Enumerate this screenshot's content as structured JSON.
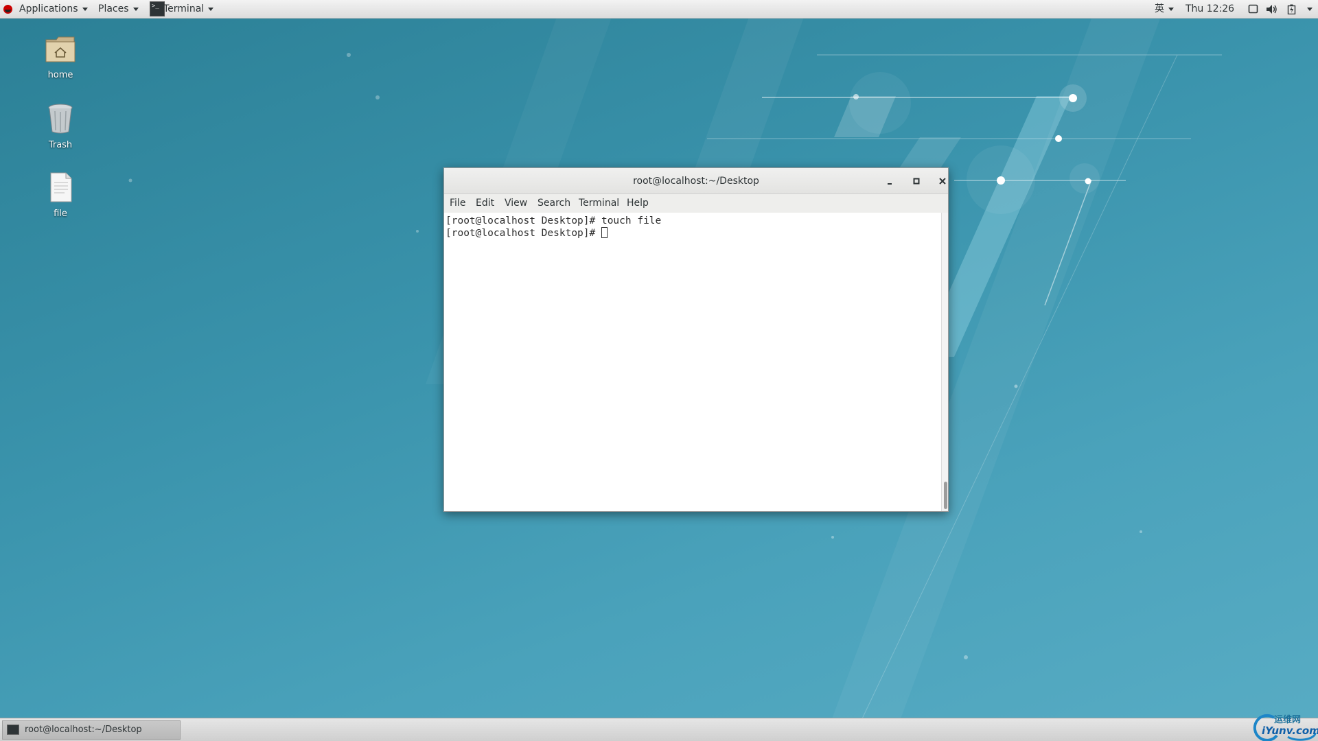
{
  "topbar": {
    "applications_label": "Applications",
    "places_label": "Places",
    "terminal_label": "Terminal",
    "input_method": "英",
    "clock": "Thu 12:26"
  },
  "desktop_icons": [
    {
      "label": "home",
      "icon": "home-folder-icon"
    },
    {
      "label": "Trash",
      "icon": "trash-icon"
    },
    {
      "label": "file",
      "icon": "file-icon"
    }
  ],
  "window": {
    "title": "root@localhost:~/Desktop",
    "menu": [
      "File",
      "Edit",
      "View",
      "Search",
      "Terminal",
      "Help"
    ],
    "lines": [
      "[root@localhost Desktop]# touch file",
      "[root@localhost Desktop]# "
    ]
  },
  "taskbar": {
    "task_label": "root@localhost:~/Desktop"
  },
  "watermark": {
    "text_cn": "运维网",
    "text_en": "iYunv.com"
  },
  "colors": {
    "desktop": "#3a93ac",
    "topbar": "#e8e8e8",
    "window_bg": "#ffffff"
  }
}
